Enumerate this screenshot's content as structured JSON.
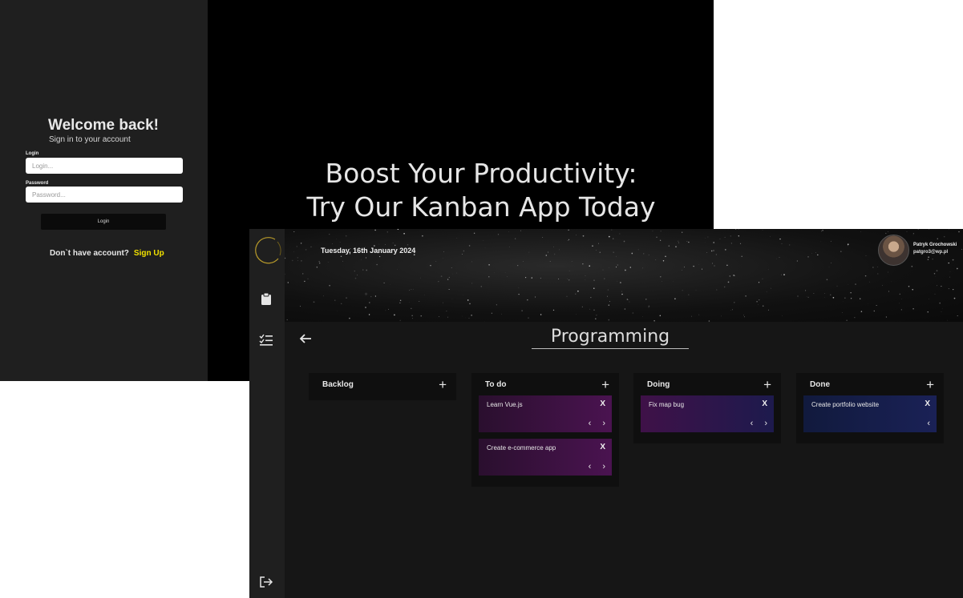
{
  "login": {
    "welcome_title": "Welcome back!",
    "welcome_subtitle": "Sign in to your account",
    "login_label": "Login",
    "login_placeholder": "Login...",
    "password_label": "Password",
    "password_placeholder": "Password...",
    "login_button": "Login",
    "no_account_text": "Don`t have account?",
    "signup_link": "Sign Up",
    "accent_color": "#f2e200"
  },
  "promo": {
    "headline_line1": "Boost Your Productivity:",
    "headline_line2": "Try Our Kanban App Today"
  },
  "kanban": {
    "date": "Tuesday, 16th January 2024",
    "user": {
      "name": "Patryk Grochowski",
      "email": "patgro3@wp.pl"
    },
    "sidebar_icons": [
      "logo-ring-icon",
      "clipboard-icon",
      "checklist-icon",
      "logout-icon"
    ],
    "board_title": "Programming",
    "add_symbol": "+",
    "delete_symbol": "X",
    "prev_symbol": "‹",
    "next_symbol": "›",
    "columns": [
      {
        "title": "Backlog",
        "cards": []
      },
      {
        "title": "To do",
        "cards": [
          {
            "text": "Learn Vue.js"
          },
          {
            "text": "Create e-commerce app"
          }
        ]
      },
      {
        "title": "Doing",
        "cards": [
          {
            "text": "Fix map bug"
          }
        ]
      },
      {
        "title": "Done",
        "cards": [
          {
            "text": "Create portfolio website"
          }
        ]
      }
    ]
  }
}
